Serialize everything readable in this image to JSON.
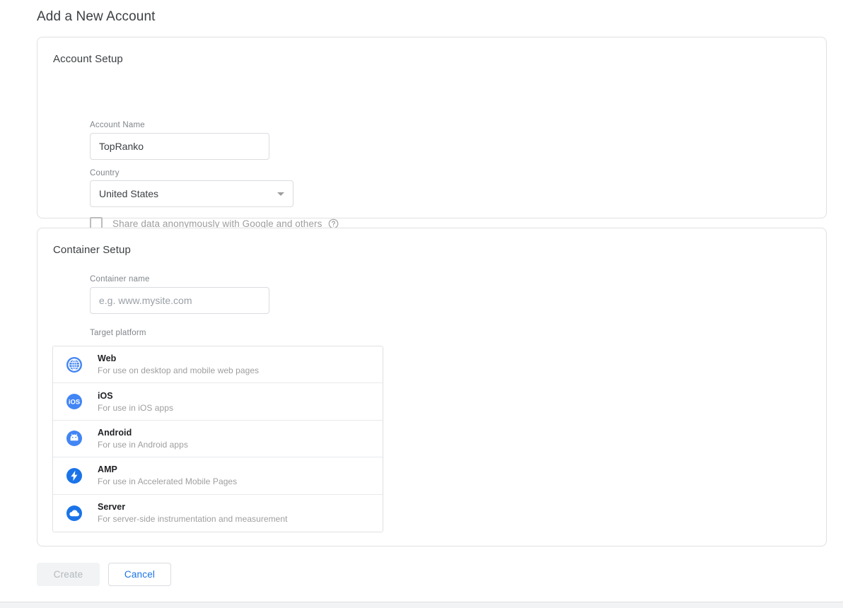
{
  "page": {
    "title": "Add a New Account"
  },
  "account_setup": {
    "section_title": "Account Setup",
    "account_name_label": "Account Name",
    "account_name_value": "TopRanko",
    "account_name_placeholder": "",
    "country_label": "Country",
    "country_value": "United States",
    "share_data_label": "Share data anonymously with Google and others",
    "share_data_checked": false,
    "help_icon": "help-circle-icon",
    "caret_icon": "chevron-down-icon"
  },
  "container_setup": {
    "section_title": "Container Setup",
    "container_name_label": "Container name",
    "container_name_value": "",
    "container_name_placeholder": "e.g. www.mysite.com",
    "target_platform_label": "Target platform",
    "platforms": [
      {
        "name": "Web",
        "description": "For use on desktop and mobile web pages",
        "icon": "globe-icon",
        "selected": false
      },
      {
        "name": "iOS",
        "description": "For use in iOS apps",
        "icon": "ios-icon",
        "selected": false
      },
      {
        "name": "Android",
        "description": "For use in Android apps",
        "icon": "android-icon",
        "selected": false
      },
      {
        "name": "AMP",
        "description": "For use in Accelerated Mobile Pages",
        "icon": "amp-bolt-icon",
        "selected": false
      },
      {
        "name": "Server",
        "description": "For server-side instrumentation and measurement",
        "icon": "cloud-icon",
        "selected": false
      }
    ]
  },
  "actions": {
    "create_label": "Create",
    "create_enabled": false,
    "cancel_label": "Cancel"
  },
  "colors": {
    "accent_blue": "#1a73e8",
    "icon_blue": "#4285f4",
    "text_primary": "#3c4043",
    "text_secondary": "#9e9e9e",
    "border": "#dadce0"
  }
}
